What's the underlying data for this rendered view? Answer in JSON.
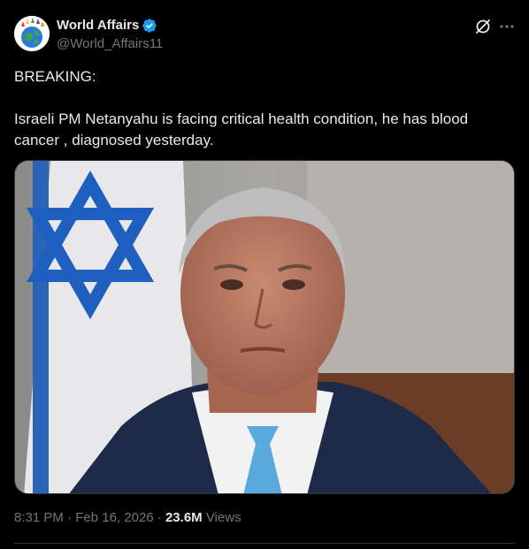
{
  "author": {
    "display_name": "World Affairs",
    "handle": "@World_Affairs11",
    "verified": true,
    "avatar_icon": "globe-hands-icon"
  },
  "actions": {
    "grok_icon": "grok-icon",
    "more_icon": "more-icon"
  },
  "tweet": {
    "text": "BREAKING:\n\nIsraeli PM Netanyahu is facing critical health condition, he has blood cancer , diagnosed yesterday."
  },
  "media": {
    "type": "photo"
  },
  "meta": {
    "time": "8:31 PM",
    "separator": "·",
    "date": "Feb 16, 2026",
    "views_count": "23.6M",
    "views_label": "Views"
  },
  "colors": {
    "background": "#000000",
    "text": "#e7e9ea",
    "secondary": "#71767b",
    "verified_blue": "#1d9bf0",
    "divider": "#2f3336"
  }
}
